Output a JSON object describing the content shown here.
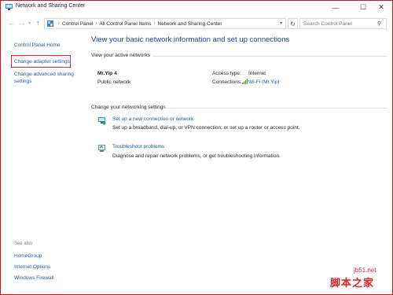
{
  "window": {
    "title": "Network and Sharing Center",
    "controls": {
      "minimize": "—",
      "maximize": "☐",
      "close": "✕"
    }
  },
  "address": {
    "back_icon": "←",
    "forward_icon": "→",
    "recent_icon": "▾",
    "up_icon": "↑",
    "breadcrumb": [
      "Control Panel",
      "All Control Panel Items",
      "Network and Sharing Center"
    ],
    "separator": "›",
    "dropdown_icon": "▾",
    "refresh_icon": "↻",
    "search_placeholder": "Search Control Panel",
    "search_icon": "⚲"
  },
  "sidebar": {
    "home": "Control Panel Home",
    "change_adapter": "Change adapter settings",
    "change_sharing": "Change advanced sharing settings",
    "see_also_label": "See also",
    "see_also": [
      "HomeGroup",
      "Internet Options",
      "Windows Firewall"
    ]
  },
  "main": {
    "heading": "View your basic network information and set up connections",
    "active_networks_label": "View your active networks",
    "network": {
      "name": "Mr.Yip  4",
      "type": "Public network",
      "access_type_label": "Access type:",
      "access_type_value": "Internet",
      "connections_label": "Connections:",
      "connections_value": "Wi-Fi (Mr.Yip)"
    },
    "change_settings_label": "Change your networking settings",
    "tasks": [
      {
        "link": "Set up a new connection or network",
        "desc": "Set up a broadband, dial-up, or VPN connection; or set up a router or access point."
      },
      {
        "link": "Troubleshoot problems",
        "desc": "Diagnose and repair network problems, or get troubleshooting information."
      }
    ]
  },
  "watermark": {
    "line1": "jb51.net",
    "line2": "脚本之家"
  },
  "colors": {
    "link": "#1a5aa6",
    "heading": "#1e3e8f",
    "highlight_box": "#e0282e",
    "frame": "#c8191e"
  }
}
